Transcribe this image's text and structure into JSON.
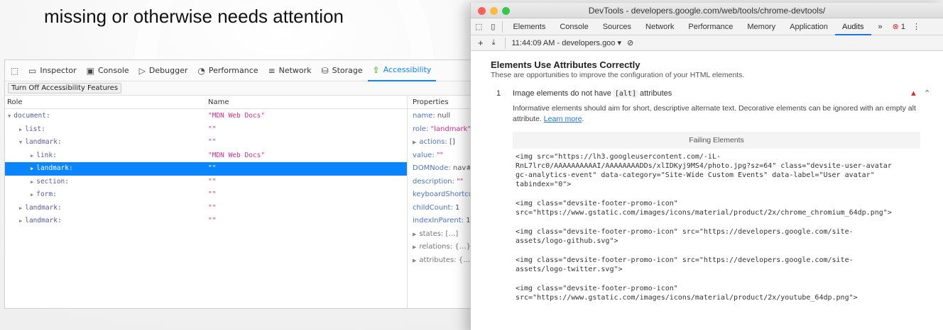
{
  "headline": "missing or otherwise needs attention",
  "firefox": {
    "toolbar": {
      "inspector": "Inspector",
      "console": "Console",
      "debugger": "Debugger",
      "performance": "Performance",
      "network": "Network",
      "storage": "Storage",
      "accessibility": "Accessibility"
    },
    "turn_off_button": "Turn Off Accessibility Features",
    "headers": {
      "role": "Role",
      "name": "Name",
      "properties": "Properties"
    },
    "rows": [
      {
        "role": "document:",
        "name": "\"MDN Web Docs\""
      },
      {
        "role": "list:",
        "name": "\"\""
      },
      {
        "role": "landmark:",
        "name": "\"\""
      },
      {
        "role": "link:",
        "name": "\"MDN Web Docs\""
      },
      {
        "role": "landmark:",
        "name": "\"\""
      },
      {
        "role": "section:",
        "name": "\"\""
      },
      {
        "role": "form:",
        "name": "\"\""
      },
      {
        "role": "landmark:",
        "name": "\"\""
      },
      {
        "role": "landmark:",
        "name": "\"\""
      }
    ],
    "properties": {
      "name_key": "name:",
      "name_val": "null",
      "role_key": "role:",
      "role_val": "\"landmark\"",
      "actions_key": "actions:",
      "actions_val": "[]",
      "value_key": "value:",
      "value_val": "\"\"",
      "domnode_key": "DOMNode:",
      "domnode_val": "nav#n",
      "description_key": "description:",
      "description_val": "\"\"",
      "keyboard_key": "keyboardShortcut:",
      "childcount_key": "childCount:",
      "childcount_val": "1",
      "index_key": "indexInParent:",
      "index_val": "1",
      "states": "states: […]",
      "relations": "relations: {…}",
      "attributes": "attributes: {…}"
    }
  },
  "chrome": {
    "window_title": "DevTools - developers.google.com/web/tools/chrome-devtools/",
    "tabs": [
      "Elements",
      "Console",
      "Sources",
      "Network",
      "Performance",
      "Memory",
      "Application",
      "Audits"
    ],
    "more_tabs": "»",
    "error_count": "1",
    "report_select": "11:44:09 AM - developers.goo ▾",
    "section_title": "Elements Use Attributes Correctly",
    "section_desc": "These are opportunities to improve the configuration of your HTML elements.",
    "audit": {
      "number": "1",
      "title_before": "Image elements do not have ",
      "title_code": "[alt]",
      "title_after": " attributes",
      "detail": "Informative elements should aim for short, descriptive alternate text. Decorative elements can be ignored with an empty alt attribute. ",
      "learn_more": "Learn more",
      "learn_more_suffix": ".",
      "failing_header": "Failing Elements",
      "failing": [
        "<img src=\"https://lh3.googleusercontent.com/-iL-\nRnL7lrc0/AAAAAAAAAAI/AAAAAAAADDs/xlIDKyj9MS4/photo.jpg?sz=64\" class=\"devsite-user-avatar\ngc-analytics-event\" data-category=\"Site-Wide Custom Events\" data-label=\"User avatar\"\ntabindex=\"0\">",
        "<img class=\"devsite-footer-promo-icon\"\nsrc=\"https://www.gstatic.com/images/icons/material/product/2x/chrome_chromium_64dp.png\">",
        "<img class=\"devsite-footer-promo-icon\" src=\"https://developers.google.com/site-\nassets/logo-github.svg\">",
        "<img class=\"devsite-footer-promo-icon\" src=\"https://developers.google.com/site-\nassets/logo-twitter.svg\">",
        "<img class=\"devsite-footer-promo-icon\"\nsrc=\"https://www.gstatic.com/images/icons/material/product/2x/youtube_64dp.png\">"
      ]
    },
    "colors": {
      "accent": "#1a73e8",
      "error": "#d93025",
      "firefox_accent": "#0a84ff"
    }
  }
}
